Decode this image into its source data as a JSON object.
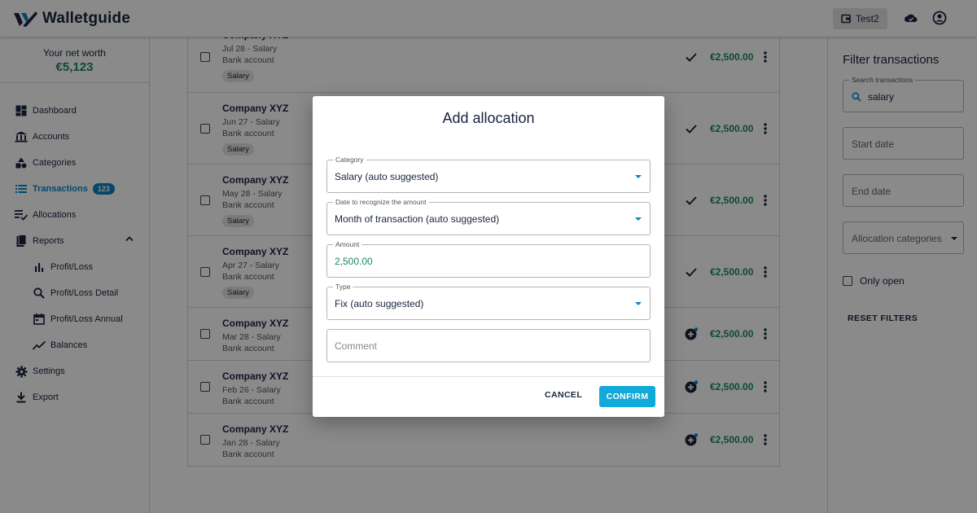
{
  "app": {
    "name": "Walletguide"
  },
  "header": {
    "account_label": "Test2"
  },
  "sidebar": {
    "networth_label": "Your net worth",
    "networth_value": "€5,123",
    "items": [
      {
        "label": "Dashboard",
        "icon": "dashboard-icon"
      },
      {
        "label": "Accounts",
        "icon": "bank-icon"
      },
      {
        "label": "Categories",
        "icon": "shapes-icon"
      },
      {
        "label": "Transactions",
        "icon": "list-icon",
        "badge": "123",
        "active": true
      },
      {
        "label": "Allocations",
        "icon": "playlist-check-icon"
      },
      {
        "label": "Reports",
        "icon": "file-icon",
        "expanded": true
      },
      {
        "label": "Profit/Loss",
        "icon": "bar-chart-icon",
        "sub": true
      },
      {
        "label": "Profit/Loss Detail",
        "icon": "search-zoom-icon",
        "sub": true
      },
      {
        "label": "Profit/Loss Annual",
        "icon": "calendar-icon",
        "sub": true
      },
      {
        "label": "Balances",
        "icon": "trend-line-icon",
        "sub": true
      },
      {
        "label": "Settings",
        "icon": "gear-icon"
      },
      {
        "label": "Export",
        "icon": "download-icon"
      }
    ]
  },
  "transactions": [
    {
      "name": "Company XYZ",
      "date_cat": "Jul 28 - Salary",
      "account": "Bank account",
      "chip": "Salary",
      "status": "allocated",
      "amount": "€2,500.00"
    },
    {
      "name": "Company XYZ",
      "date_cat": "Jun 27 - Salary",
      "account": "Bank account",
      "chip": "Salary",
      "status": "allocated",
      "amount": "€2,500.00"
    },
    {
      "name": "Company XYZ",
      "date_cat": "May 28 - Salary",
      "account": "Bank account",
      "chip": "Salary",
      "status": "allocated",
      "amount": "€2,500.00"
    },
    {
      "name": "Company XYZ",
      "date_cat": "Apr 27 - Salary",
      "account": "Bank account",
      "chip": "Salary",
      "status": "allocated",
      "amount": "€2,500.00"
    },
    {
      "name": "Company XYZ",
      "date_cat": "Mar 28 - Salary",
      "account": "Bank account",
      "chip": "",
      "status": "open",
      "amount": "€2,500.00"
    },
    {
      "name": "Company XYZ",
      "date_cat": "Feb 26 - Salary",
      "account": "Bank account",
      "chip": "",
      "status": "open",
      "amount": "€2,500.00"
    },
    {
      "name": "Company XYZ",
      "date_cat": "Jan 28 - Salary",
      "account": "Bank account",
      "chip": "",
      "status": "open",
      "amount": "€2,500.00"
    }
  ],
  "filter": {
    "title": "Filter transactions",
    "search_label": "Search transactions",
    "search_value": "salary",
    "start_date_placeholder": "Start date",
    "end_date_placeholder": "End date",
    "allocation_categories_placeholder": "Allocation categories",
    "only_open_label": "Only open",
    "reset_label": "RESET FILTERS"
  },
  "dialog": {
    "title": "Add allocation",
    "category_label": "Category",
    "category_value": "Salary (auto suggested)",
    "date_label": "Date to recognize the amount",
    "date_value": "Month of transaction (auto suggested)",
    "amount_label": "Amount",
    "amount_value": "2,500.00",
    "type_label": "Type",
    "type_value": "Fix (auto suggested)",
    "comment_placeholder": "Comment",
    "cancel_label": "CANCEL",
    "confirm_label": "CONFIRM"
  },
  "colors": {
    "accent": "#0a86c8",
    "brand_dark": "#1a2440",
    "amount_green": "#1b8a5c",
    "confirm": "#10a9d8"
  }
}
